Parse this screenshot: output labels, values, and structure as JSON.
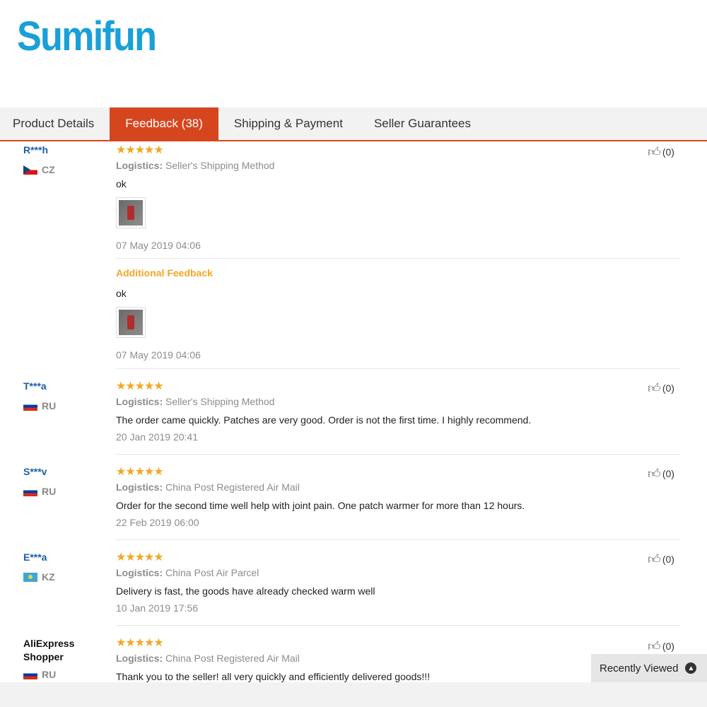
{
  "brand": {
    "logo_text": "Sumifun",
    "color": "#1aa0d8"
  },
  "tabs": [
    {
      "label": "Product Details",
      "active": false
    },
    {
      "label": "Feedback (38)",
      "active": true
    },
    {
      "label": "Shipping & Payment",
      "active": false
    },
    {
      "label": "Seller Guarantees",
      "active": false
    }
  ],
  "accent_color": "#d6461e",
  "reviews": [
    {
      "user": "R***h",
      "country": "CZ",
      "stars": "★★★★★",
      "logistics_label": "Logistics:",
      "logistics": "Seller's Shipping Method",
      "text": "ok",
      "date": "07 May 2019 04:06",
      "additional_label": "Additional Feedback",
      "additional_text": "ok",
      "additional_date": "07 May 2019 04:06",
      "likes": "(0)"
    },
    {
      "user": "T***a",
      "country": "RU",
      "stars": "★★★★★",
      "logistics_label": "Logistics:",
      "logistics": "Seller's Shipping Method",
      "text": "The order came quickly. Patches are very good. Order is not the first time. I highly recommend.",
      "date": "20 Jan 2019 20:41",
      "likes": "(0)"
    },
    {
      "user": "S***v",
      "country": "RU",
      "stars": "★★★★★",
      "logistics_label": "Logistics:",
      "logistics": "China Post Registered Air Mail",
      "text": "Order for the second time well help with joint pain. One patch warmer for more than 12 hours.",
      "date": "22 Feb 2019 06:00",
      "likes": "(0)"
    },
    {
      "user": "E***a",
      "country": "KZ",
      "stars": "★★★★★",
      "logistics_label": "Logistics:",
      "logistics": "China Post Air Parcel",
      "text": "Delivery is fast, the goods have already checked warm well",
      "date": "10 Jan 2019 17:56",
      "likes": "(0)"
    },
    {
      "user": "AliExpress Shopper",
      "country": "RU",
      "stars": "★★★★★",
      "logistics_label": "Logistics:",
      "logistics": "China Post Registered Air Mail",
      "text": "Thank you to the seller! all very quickly and efficiently delivered goods!!!",
      "likes": "(0)"
    }
  ],
  "recently_viewed": {
    "label": "Recently Viewed"
  }
}
